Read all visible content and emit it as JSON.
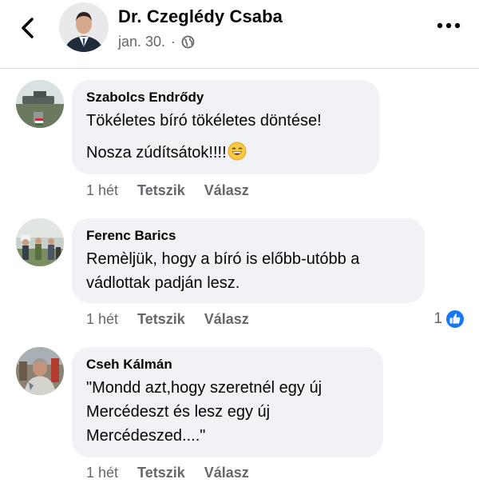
{
  "header": {
    "page_name": "Dr. Czeglédy Csaba",
    "date": "jan. 30.",
    "separator": "·",
    "icons": {
      "back": "chevron-left-icon",
      "audience": "globe-icon",
      "more": "more-dots-icon"
    }
  },
  "comments": [
    {
      "author": "Szabolcs Endrődy",
      "lines": [
        "Tökéletes bíró tökéletes döntése!",
        "Nosza zúdítsátok!!!!"
      ],
      "emoji": "grinning-face-emoji",
      "time": "1 hét",
      "like_label": "Tetszik",
      "reply_label": "Válasz"
    },
    {
      "author": "Ferenc Barics",
      "lines": [
        "Remèljük, hogy a bíró is előbb-utóbb a",
        "vádlottak padján lesz."
      ],
      "time": "1 hét",
      "like_label": "Tetszik",
      "reply_label": "Válasz",
      "reaction_count": "1"
    },
    {
      "author": "Cseh Kálmán",
      "lines": [
        "\"Mondd azt,hogy szeretnél egy új",
        "Mercédeszt és lesz egy új",
        "Mercédeszed....\""
      ],
      "time": "1 hét",
      "like_label": "Tetszik",
      "reply_label": "Válasz"
    }
  ],
  "colors": {
    "bubble": "#f0f2f5",
    "meta_text": "#65676b",
    "like_blue": "#1877f2"
  }
}
